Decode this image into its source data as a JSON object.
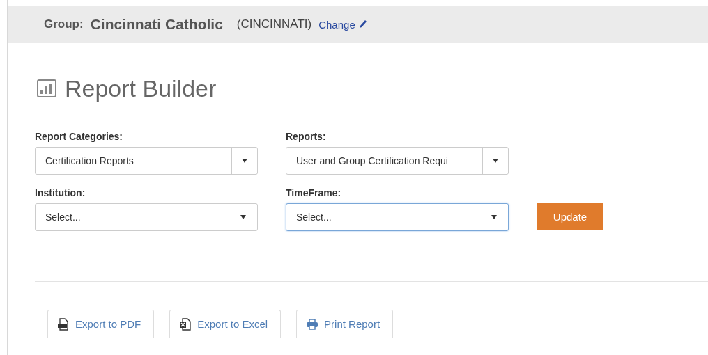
{
  "group_bar": {
    "label": "Group:",
    "name": "Cincinnati Catholic",
    "city": "(CINCINNATI)",
    "change_link": "Change"
  },
  "title": "Report Builder",
  "fields": [
    {
      "label": "Report Categories:",
      "value": "Certification Reports",
      "kind": "split",
      "focused": false
    },
    {
      "label": "Reports:",
      "value": "User and Group Certification Requi",
      "kind": "split",
      "focused": false
    },
    {
      "label": "Institution:",
      "value": "Select...",
      "kind": "plain",
      "focused": false
    },
    {
      "label": "TimeFrame:",
      "value": "Select...",
      "kind": "plain",
      "focused": true
    }
  ],
  "update_button": "Update",
  "export_buttons": [
    {
      "label": "Export to PDF",
      "kind": "pdf"
    },
    {
      "label": "Export to Excel",
      "kind": "excel"
    },
    {
      "label": "Print Report",
      "kind": "print"
    }
  ]
}
